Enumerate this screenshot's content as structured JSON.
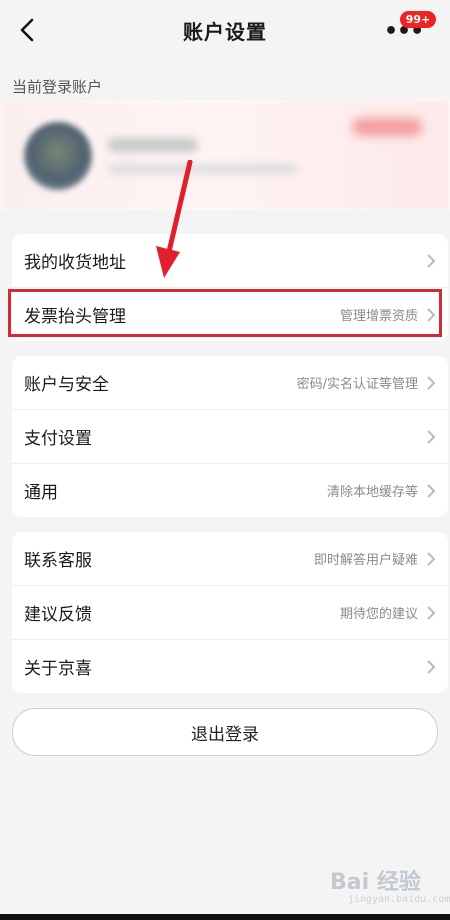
{
  "header": {
    "title": "账户设置",
    "badge": "99+",
    "more_icon": "more-dots-icon"
  },
  "account": {
    "section_label": "当前登录账户"
  },
  "group1": [
    {
      "label": "我的收货地址",
      "hint": ""
    },
    {
      "label": "发票抬头管理",
      "hint": "管理增票资质"
    }
  ],
  "group2": [
    {
      "label": "账户与安全",
      "hint": "密码/实名认证等管理"
    },
    {
      "label": "支付设置",
      "hint": ""
    },
    {
      "label": "通用",
      "hint": "清除本地缓存等"
    }
  ],
  "group3": [
    {
      "label": "联系客服",
      "hint": "即时解答用户疑难"
    },
    {
      "label": "建议反馈",
      "hint": "期待您的建议"
    },
    {
      "label": "关于京喜",
      "hint": ""
    }
  ],
  "logout": {
    "label": "退出登录"
  },
  "watermark": {
    "text": "Bai 经验",
    "sub": "jingyan.baidu.com"
  },
  "colors": {
    "accent": "#ee2323",
    "highlight": "#d42a36"
  }
}
